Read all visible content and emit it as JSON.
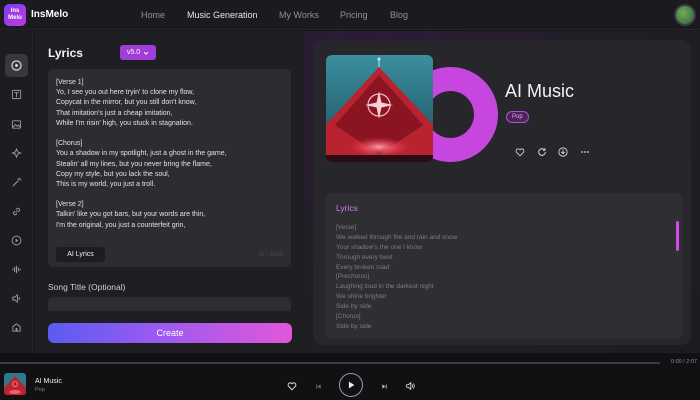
{
  "app": {
    "brand": "InsMelo",
    "logo_text": "Ins Melo"
  },
  "nav": {
    "items": [
      "Home",
      "Music Generation",
      "My Works",
      "Pricing",
      "Blog"
    ],
    "active": "Music Generation"
  },
  "sidebar": {
    "icons": [
      "disc-icon",
      "lyrics-doc-icon",
      "image-icon",
      "sparkle-icon",
      "magic-wand-icon",
      "link-icon",
      "play-circle-icon",
      "waveform-icon",
      "volume-icon",
      "studio-icon"
    ],
    "active": "disc-icon"
  },
  "editor": {
    "title": "Lyrics",
    "version": "v5.0",
    "lyrics_lines": [
      "[Verse 1]",
      "Yo, I see you out here tryin' to clone my flow,",
      "Copycat in the mirror, but you still don't know,",
      "That imitation's just a cheap imitation,",
      "While I'm risin' high, you stuck in stagnation.",
      "",
      "[Chorus]",
      "You a shadow in my spotlight, just a ghost in the game,",
      "Stealin' all my lines, but you never bring the flame,",
      "Copy my style, but you lack the soul,",
      "This is my world, you just a troll.",
      "",
      "[Verse 2]",
      "Talkin' like you got bars, but your words are thin,",
      "I'm the original, you just a counterfeit grin,"
    ],
    "ai_lyrics_button": "AI Lyrics",
    "char_count": "1k / 5000",
    "song_title_label": "Song Title (Optional)",
    "song_title_value": "",
    "create_button": "Create"
  },
  "result": {
    "song_title": "AI Music",
    "genre": "Pop",
    "actions": [
      "heart-icon",
      "remix-icon",
      "download-icon",
      "more-icon"
    ],
    "lyrics_title": "Lyrics",
    "lyrics_lines": [
      "[Verse]",
      "We walked through fire and rain and snow",
      "Your shadow's the one I know",
      "Through every twist",
      "Every broken road",
      "[Prechorus]",
      "Laughing loud in the darkest night",
      "We shine brighter",
      "Side by side",
      "[Chorus]",
      "Side by side"
    ]
  },
  "player": {
    "title": "AI Music",
    "genre": "Pop",
    "time": "0:00 / 2:07",
    "progress": 0
  },
  "colors": {
    "accent": "#c746e0",
    "create_start": "#5a5cf0",
    "create_end": "#e157d8"
  }
}
